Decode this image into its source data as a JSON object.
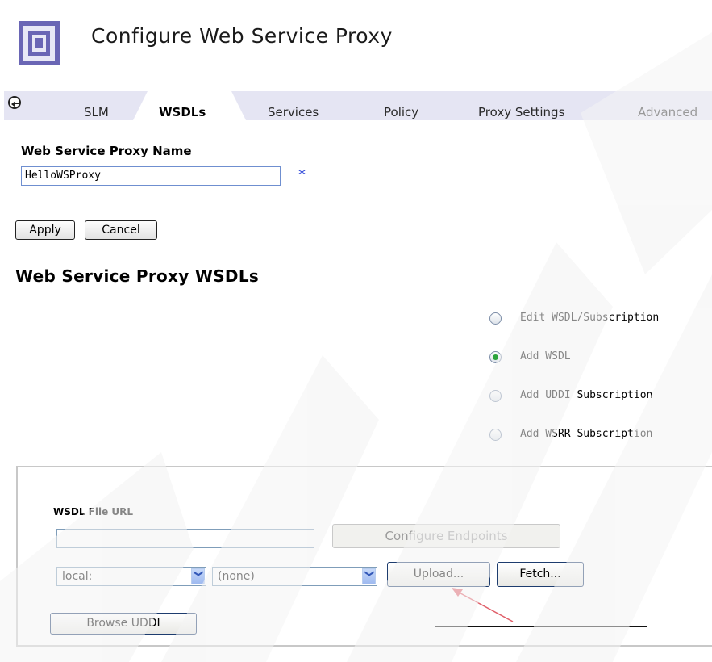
{
  "page": {
    "title": "Configure Web Service Proxy"
  },
  "tabs": [
    {
      "label": "SLM"
    },
    {
      "label": "WSDLs",
      "active": true
    },
    {
      "label": "Services"
    },
    {
      "label": "Policy"
    },
    {
      "label": "Proxy Settings"
    },
    {
      "label": "Advanced"
    }
  ],
  "proxy_name": {
    "label": "Web Service Proxy Name",
    "value": "HelloWSProxy",
    "required_marker": "*"
  },
  "actions": {
    "apply": "Apply",
    "cancel": "Cancel"
  },
  "section_title": "Web Service Proxy WSDLs",
  "options": [
    {
      "label": "Edit WSDL/Subscription",
      "checked": false
    },
    {
      "label": "Add WSDL",
      "checked": true
    },
    {
      "label": "Add UDDI Subscription",
      "checked": false
    },
    {
      "label": "Add WSRR Subscription",
      "checked": false
    }
  ],
  "wsdl_panel": {
    "label": "WSDL File URL",
    "url_value": "",
    "configure_endpoints": "Configure Endpoints",
    "location_select": "local:",
    "file_select": "(none)",
    "upload": "Upload...",
    "fetch": "Fetch...",
    "browse_uddi": "Browse UDDI"
  },
  "colors": {
    "tab_bar": "#e5e5f3",
    "logo": "#6a66b5",
    "required": "#2a43d8",
    "radio_checked": "#2da43c",
    "annotation_arrow": "#e0606a"
  }
}
